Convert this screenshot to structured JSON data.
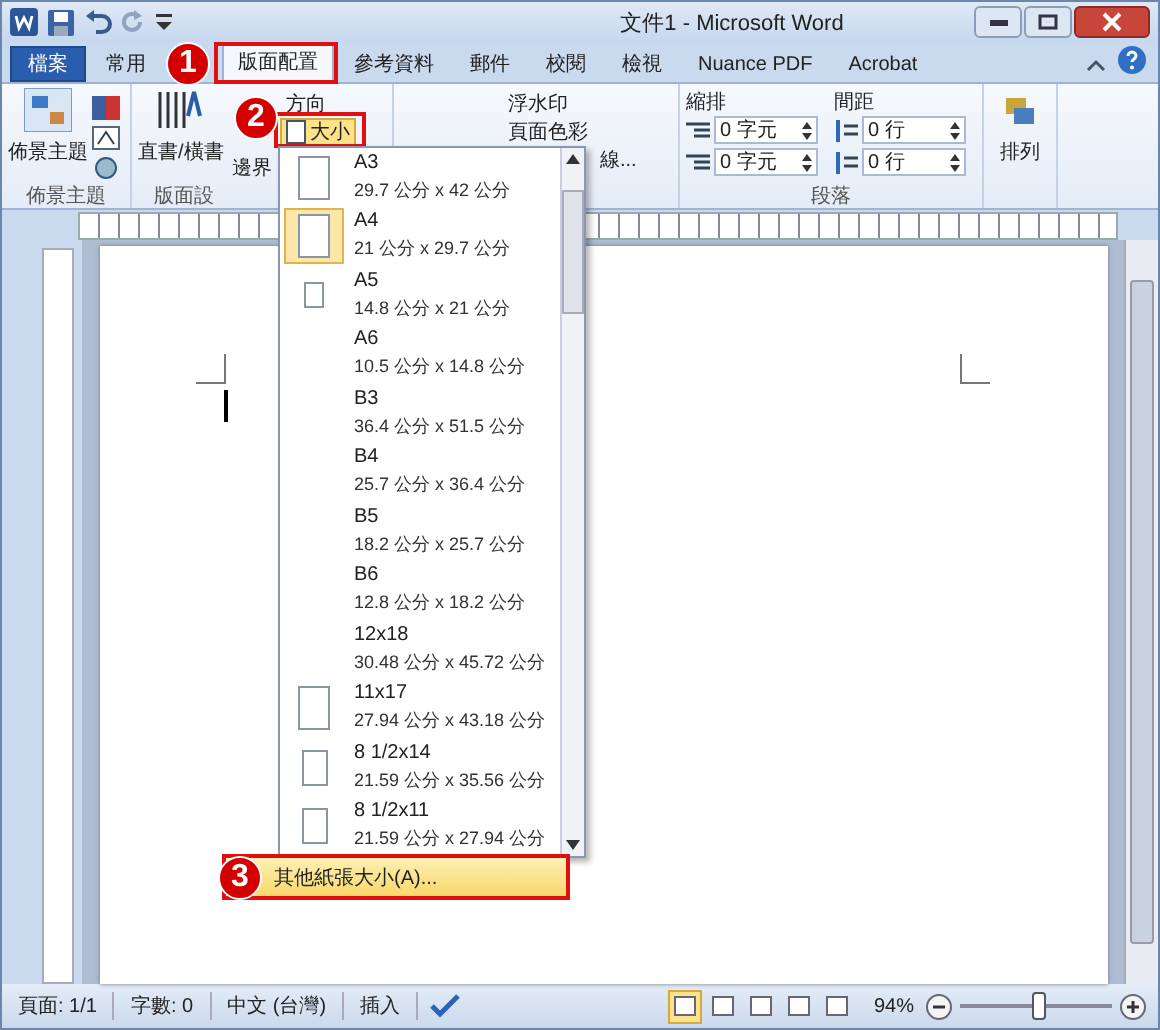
{
  "title_bar": {
    "title": "文件1 - Microsoft Word"
  },
  "tabs": [
    {
      "label": "檔案",
      "kind": "file",
      "selected": false
    },
    {
      "label": "常用",
      "kind": "tab",
      "selected": false
    },
    {
      "label": "版面配置",
      "kind": "tab",
      "selected": true
    },
    {
      "label": "參考資料",
      "kind": "tab",
      "selected": false
    },
    {
      "label": "郵件",
      "kind": "tab",
      "selected": false
    },
    {
      "label": "校閱",
      "kind": "tab",
      "selected": false
    },
    {
      "label": "檢視",
      "kind": "tab",
      "selected": false
    },
    {
      "label": "Nuance PDF",
      "kind": "tab",
      "selected": false
    },
    {
      "label": "Acrobat",
      "kind": "tab",
      "selected": false
    }
  ],
  "ribbon": {
    "theme_group": {
      "button": "佈景主題",
      "label": "佈景主題"
    },
    "page_setup_group": {
      "text_direction": "直書/橫書",
      "margins": "邊界",
      "orientation": "方向",
      "size": "大小",
      "label": "版面設"
    },
    "background_group": {
      "items": [
        "浮水印",
        "頁面色彩",
        "線..."
      ]
    },
    "paragraph_group": {
      "indent_label": "縮排",
      "spacing_label": "間距",
      "indent_fields": [
        "0 字元",
        "0 字元"
      ],
      "spacing_fields": [
        "0 行",
        "0 行"
      ],
      "label": "段落"
    },
    "arrange_group": {
      "button": "排列"
    }
  },
  "size_menu": {
    "items": [
      {
        "name": "A3",
        "dims": "29.7 公分 x 42 公分",
        "kind": "large",
        "selected": false
      },
      {
        "name": "A4",
        "dims": "21 公分 x 29.7 公分",
        "kind": "large",
        "selected": true
      },
      {
        "name": "A5",
        "dims": "14.8 公分 x 21 公分",
        "kind": "small",
        "selected": false
      },
      {
        "name": "A6",
        "dims": "10.5 公分 x 14.8 公分",
        "kind": "blank",
        "selected": false
      },
      {
        "name": "B3",
        "dims": "36.4 公分 x 51.5 公分",
        "kind": "blank",
        "selected": false
      },
      {
        "name": "B4",
        "dims": "25.7 公分 x 36.4 公分",
        "kind": "blank",
        "selected": false
      },
      {
        "name": "B5",
        "dims": "18.2 公分 x 25.7 公分",
        "kind": "blank",
        "selected": false
      },
      {
        "name": "B6",
        "dims": "12.8 公分 x 18.2 公分",
        "kind": "blank",
        "selected": false
      },
      {
        "name": "12x18",
        "dims": "30.48 公分 x 45.72 公分",
        "kind": "blank",
        "selected": false
      },
      {
        "name": "11x17",
        "dims": "27.94 公分 x 43.18 公分",
        "kind": "large",
        "selected": false
      },
      {
        "name": "8 1/2x14",
        "dims": "21.59 公分 x 35.56 公分",
        "kind": "medium",
        "selected": false
      },
      {
        "name": "8 1/2x11",
        "dims": "21.59 公分 x 27.94 公分",
        "kind": "medium",
        "selected": false
      }
    ],
    "more": "其他紙張大小(A)..."
  },
  "callouts": [
    "1",
    "2",
    "3"
  ],
  "status_bar": {
    "items": [
      "頁面: 1/1",
      "字數: 0",
      "中文 (台灣)",
      "插入"
    ],
    "views": [
      {
        "selected": true
      },
      {
        "selected": false
      },
      {
        "selected": false
      },
      {
        "selected": false
      },
      {
        "selected": false
      }
    ],
    "zoom": "94%",
    "zoom_slider": {
      "level": 0.5
    }
  }
}
